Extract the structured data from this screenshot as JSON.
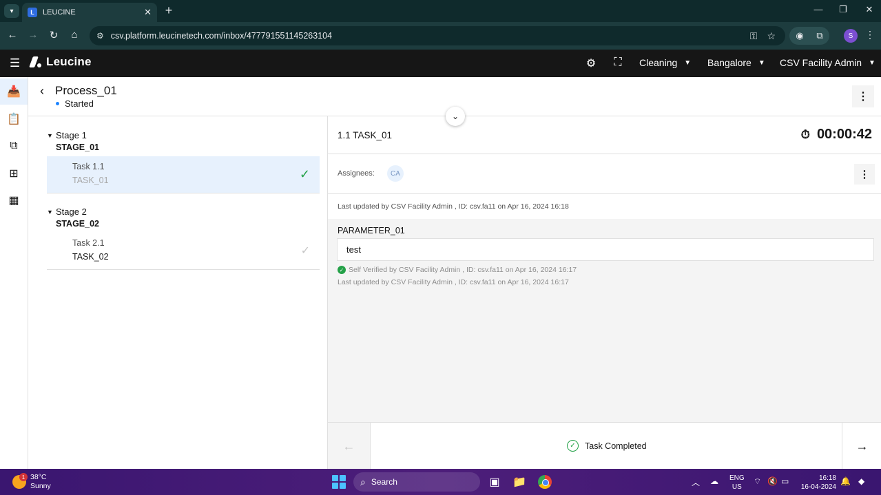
{
  "browser": {
    "tab_title": "LEUCINE",
    "tab_favicon_letter": "L",
    "url": "csv.platform.leucinetech.com/inbox/477791551145263104",
    "profile_letter": "S"
  },
  "header": {
    "logo_text": "Leucine",
    "use_case": "Cleaning",
    "facility": "Bangalore",
    "user": "CSV Facility Admin"
  },
  "process": {
    "title": "Process_01",
    "status": "Started"
  },
  "stages": [
    {
      "label": "Stage 1",
      "name": "STAGE_01",
      "task_label": "Task 1.1",
      "task_name": "TASK_01"
    },
    {
      "label": "Stage 2",
      "name": "STAGE_02",
      "task_label": "Task 2.1",
      "task_name": "TASK_02"
    }
  ],
  "task": {
    "title": "1.1 TASK_01",
    "timer": "00:00:42",
    "assignees_label": "Assignees:",
    "assignee_initials": "CA",
    "last_updated": "Last updated by CSV Facility Admin , ID: csv.fa11 on Apr 16, 2024 16:18"
  },
  "parameter": {
    "label": "PARAMETER_01",
    "value": "test",
    "verified": "Self Verified by CSV Facility Admin , ID: csv.fa11 on Apr 16, 2024 16:17",
    "updated": "Last updated by CSV Facility Admin , ID: csv.fa11 on Apr 16, 2024 16:17"
  },
  "footer": {
    "status": "Task Completed"
  },
  "taskbar": {
    "temp": "38°C",
    "condition": "Sunny",
    "weather_badge": "1",
    "search": "Search",
    "lang_top": "ENG",
    "lang_bottom": "US",
    "time": "16:18",
    "date": "16-04-2024"
  },
  "colors": {
    "accent": "#1d84ff",
    "success": "#24a148",
    "header_bg": "#161616"
  }
}
